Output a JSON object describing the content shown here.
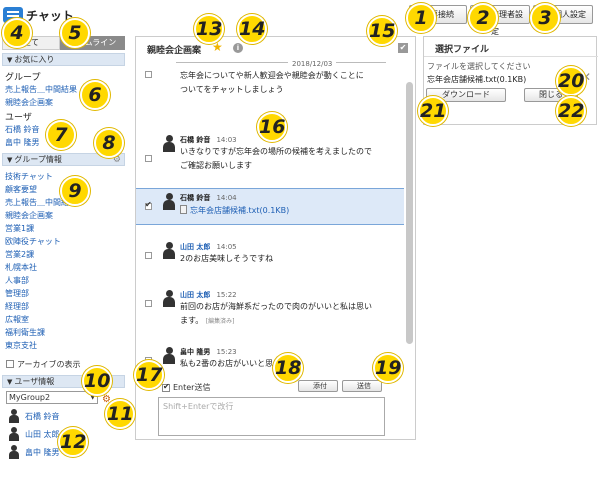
{
  "header": {
    "title": "チャット",
    "reconnect_label": "再接続",
    "admin_settings_label": "管理者設定",
    "personal_settings_label": "個人設定"
  },
  "left": {
    "tab_all": "全て",
    "tab_timeline": "タイムライン",
    "favorites_header": "お気に入り",
    "group_label": "グループ",
    "favorite_groups": [
      "売上報告＿中間結果",
      "親睦会企画案"
    ],
    "user_label": "ユーザ",
    "favorite_users": [
      "石橋 鈴音",
      "畠中 隆男"
    ],
    "group_info_header": "グループ情報",
    "groups": [
      "技術チャット",
      "顧客要望",
      "売上報告＿中間結果",
      "親睦会企画案",
      "営業1課",
      "欧陣役チャット",
      "営業2課",
      "札幌本社",
      "人事部",
      "管理部",
      "経理部",
      "広報室",
      "福利衛生課",
      "東京支社"
    ],
    "archive_label": "アーカイブの表示",
    "user_info_header": "ユーザ情報",
    "group_select_value": "MyGroup2",
    "group_users": [
      "石橋 鈴音",
      "山田 太郎",
      "畠中 隆男"
    ]
  },
  "chat": {
    "title": "親睦会企画案",
    "date": "2018/12/03",
    "messages": [
      {
        "name": "",
        "time": "",
        "text1": "忘年会についてや新人歓迎会や親睦会が動くことに",
        "text2": "ついてをチャットしましょう"
      },
      {
        "name": "石橋 鈴音",
        "time": "14:03",
        "text1": "いきなりですが忘年会の場所の候補を考えましたので",
        "text2": "ご確認お願いします"
      },
      {
        "name": "石橋 鈴音",
        "time": "14:04",
        "file": "忘年会店舗候補.txt(0.1KB)"
      },
      {
        "name": "山田 太郎",
        "time": "14:05",
        "text1": "2のお店美味しそうですね"
      },
      {
        "name": "山田 太郎",
        "time": "15:22",
        "text1": "前回のお店が海鮮系だったので肉のがいいと私は思い",
        "text2": "ます。",
        "edited": "[編集済み]"
      },
      {
        "name": "畠中 隆男",
        "time": "15:23",
        "text1": "私も2番のお店がいいと思います"
      }
    ],
    "enter_send_label": "Enter送信",
    "attach_label": "添付",
    "send_label": "送信",
    "input_placeholder": "Shift+Enterで改行"
  },
  "file_panel": {
    "title": "選択ファイル",
    "hint": "ファイルを選択してください",
    "file_name": "忘年会店舗候補.txt(0.1KB)",
    "download_label": "ダウンロード",
    "close_label": "閉じる"
  },
  "callouts": [
    "1",
    "2",
    "3",
    "4",
    "5",
    "6",
    "7",
    "8",
    "9",
    "10",
    "11",
    "12",
    "13",
    "14",
    "15",
    "16",
    "17",
    "18",
    "19",
    "20",
    "21",
    "22"
  ]
}
